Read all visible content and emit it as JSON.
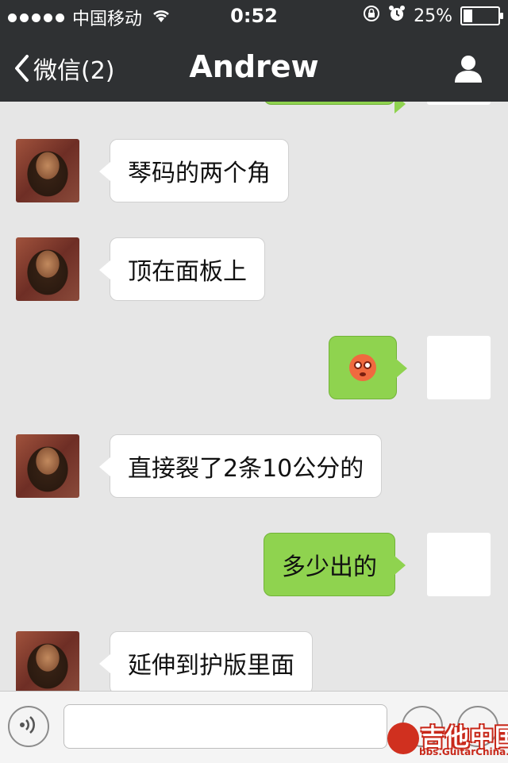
{
  "status_bar": {
    "carrier": "中国移动",
    "time": "0:52",
    "battery": "25%",
    "battery_level": 0.25
  },
  "nav": {
    "back_label": "微信(2)",
    "title": "Andrew"
  },
  "messages": [
    {
      "direction": "in",
      "text": "琴码的两个角"
    },
    {
      "direction": "in",
      "text": "顶在面板上"
    },
    {
      "direction": "out",
      "emoji": "flushed-face-emoji"
    },
    {
      "direction": "in",
      "text": "直接裂了2条10公分的"
    },
    {
      "direction": "out",
      "text": "多少出的"
    },
    {
      "direction": "in",
      "text": "延伸到护版里面"
    }
  ],
  "input": {
    "value": "",
    "placeholder": ""
  },
  "watermark": {
    "title": "吉他中国",
    "url": "bbs.GuitarChina.com"
  },
  "colors": {
    "nav_bg": "#2f3133",
    "chat_bg": "#e6e6e6",
    "outgoing_bubble": "#8fd34f",
    "incoming_bubble": "#ffffff"
  }
}
